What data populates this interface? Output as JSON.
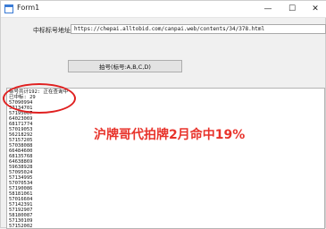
{
  "window": {
    "title": "Form1",
    "minimize_glyph": "—",
    "maximize_glyph": "☐",
    "close_glyph": "✕"
  },
  "form": {
    "url_label": "中标标号地址:",
    "url_value": "https://chepai.alltobid.com/canpai.web/contents/34/378.html",
    "button_label": "拍号(标号:A,B,C,D)"
  },
  "log": {
    "lines": [
      "标号共计192: 正在查询中",
      "已中标: 29",
      "57090994",
      "57134701",
      "57195007",
      "64023069",
      "68171774",
      "57019053",
      "56218292",
      "57157205",
      "57038088",
      "66484600",
      "68135768",
      "64638869",
      "59638928",
      "57095024",
      "57134995",
      "57070534",
      "57190086",
      "58181061",
      "57016604",
      "57142391",
      "57192907",
      "58180087",
      "57130109",
      "57152002"
    ]
  },
  "overlay": {
    "text": "沪牌哥代拍牌2月命中19%",
    "color": "#e8332b"
  },
  "colors": {
    "annotation_ring": "#e02020"
  }
}
